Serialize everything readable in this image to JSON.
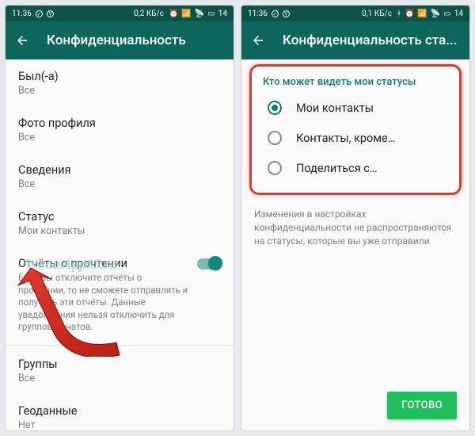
{
  "status": {
    "time": "11:36",
    "speed_left": "0,2 КБ/с",
    "speed_right": "0,1 КБ/с",
    "battery": "14"
  },
  "left": {
    "title": "Конфиденциальность",
    "items": {
      "last_seen": {
        "title": "Был(-а)",
        "value": "Все"
      },
      "photo": {
        "title": "Фото профиля",
        "value": "Все"
      },
      "about": {
        "title": "Сведения",
        "value": "Все"
      },
      "status": {
        "title": "Статус",
        "value": "Мои контакты"
      },
      "read_receipts": {
        "title": "Отчёты о прочтении",
        "desc": "Если вы отключите отчёты о прочтении, то не сможете отправлять и получать эти отчёты. Данные уведомления нельзя отключить для групповых чатов."
      },
      "groups": {
        "title": "Группы",
        "value": "Все"
      },
      "geo": {
        "title": "Геоданные",
        "value": "Нет"
      }
    },
    "watermark": "WhatsApp03.ru"
  },
  "right": {
    "title": "Конфиденциальность ста...",
    "section": "Кто может видеть мои статусы",
    "options": {
      "contacts": "Мои контакты",
      "except": "Контакты, кроме…",
      "share": "Поделиться с…"
    },
    "note": "Изменения в настройках конфиденциальности не распространяются на статусы, которые вы уже отправили",
    "done": "ГОТОВО"
  }
}
